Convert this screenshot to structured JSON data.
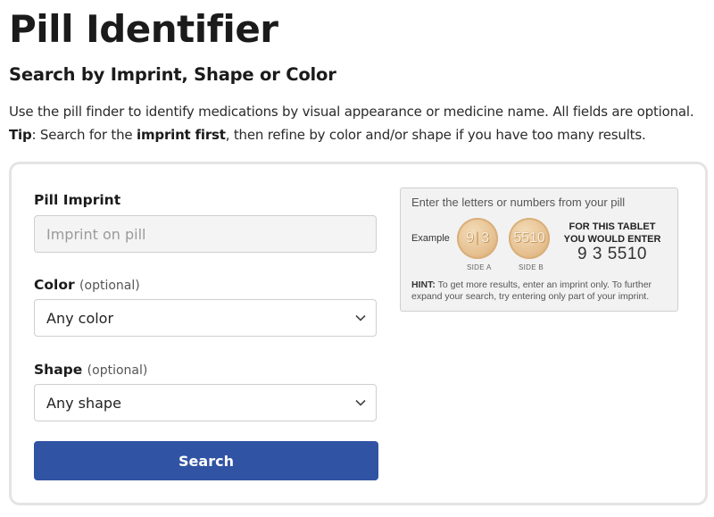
{
  "page": {
    "title": "Pill Identifier",
    "subtitle": "Search by Imprint, Shape or Color",
    "intro": "Use the pill finder to identify medications by visual appearance or medicine name. All fields are optional.",
    "tip_label": "Tip",
    "tip_pre": ": Search for the ",
    "tip_bold": "imprint first",
    "tip_post": ", then refine by color and/or shape if you have too many results."
  },
  "form": {
    "imprint": {
      "label": "Pill Imprint",
      "placeholder": "Imprint on pill",
      "value": ""
    },
    "color": {
      "label": "Color",
      "optional": "(optional)",
      "value": "Any color"
    },
    "shape": {
      "label": "Shape",
      "optional": "(optional)",
      "value": "Any shape"
    },
    "search_label": "Search"
  },
  "example": {
    "title": "Enter the letters or numbers from your pill",
    "word": "Example",
    "side_a_left": "9",
    "side_a_right": "3",
    "side_b": "5510",
    "side_a_label": "SIDE A",
    "side_b_label": "SIDE B",
    "enter_heading": "FOR THIS TABLET YOU WOULD ENTER",
    "enter_value": "9 3 5510",
    "hint_label": "HINT:",
    "hint_text": " To get more results, enter an imprint only. To further expand your search, try entering only part of your imprint."
  },
  "colors": {
    "accent": "#3153a4",
    "card_border": "#e4e4e4",
    "input_bg": "#f4f4f4"
  },
  "icons": {
    "dropdown": "chevron-down-icon"
  }
}
